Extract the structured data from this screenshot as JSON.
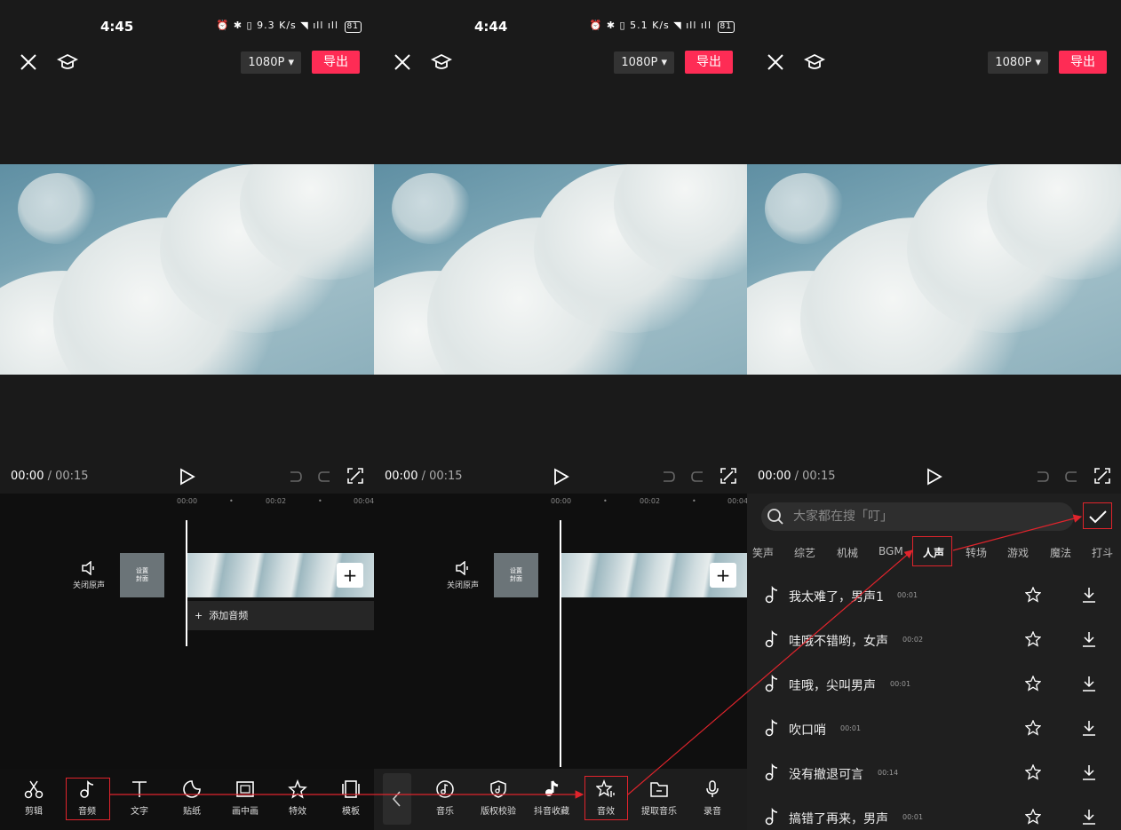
{
  "screen1": {
    "clock": "4:45",
    "net_speed": "9.3 K/s",
    "battery": "81",
    "resolution": "1080P",
    "export_label": "导出",
    "current_time": "00:00",
    "total_time": " / 00:15",
    "ruler": [
      "00:00",
      "00:02",
      "00:04"
    ],
    "mute_label": "关闭原声",
    "cover_label": [
      "设置",
      "封面"
    ],
    "add_audio_label": "添加音频",
    "tools": [
      {
        "label": "剪辑",
        "icon": "scissors-icon"
      },
      {
        "label": "音频",
        "icon": "music-note-icon"
      },
      {
        "label": "文字",
        "icon": "text-icon"
      },
      {
        "label": "贴纸",
        "icon": "sticker-icon"
      },
      {
        "label": "画中画",
        "icon": "picture-in-picture-icon"
      },
      {
        "label": "特效",
        "icon": "effects-star-icon"
      },
      {
        "label": "模板",
        "icon": "template-icon"
      }
    ]
  },
  "screen2": {
    "clock": "4:44",
    "net_speed": "5.1 K/s",
    "battery": "81",
    "resolution": "1080P",
    "export_label": "导出",
    "current_time": "00:00",
    "total_time": " / 00:15",
    "ruler": [
      "00:00",
      "00:02",
      "00:04"
    ],
    "mute_label": "关闭原声",
    "cover_label": [
      "设置",
      "封面"
    ],
    "audio_tools": [
      {
        "label": "音乐",
        "icon": "music-disc-icon"
      },
      {
        "label": "版权校验",
        "icon": "shield-check-icon"
      },
      {
        "label": "抖音收藏",
        "icon": "tiktok-icon"
      },
      {
        "label": "音效",
        "icon": "sound-effect-icon"
      },
      {
        "label": "提取音乐",
        "icon": "folder-icon"
      },
      {
        "label": "录音",
        "icon": "microphone-icon"
      }
    ]
  },
  "screen3": {
    "resolution": "1080P",
    "export_label": "导出",
    "current_time": "00:00",
    "total_time": " / 00:15",
    "search_placeholder": "大家都在搜「叮」",
    "categories": [
      "笑声",
      "综艺",
      "机械",
      "BGM",
      "人声",
      "转场",
      "游戏",
      "魔法",
      "打斗"
    ],
    "active_category": "人声",
    "sounds": [
      {
        "title": "我太难了，男声1",
        "duration": "00:01"
      },
      {
        "title": "哇哦不错哟，女声",
        "duration": "00:02"
      },
      {
        "title": "哇哦，尖叫男声",
        "duration": "00:01"
      },
      {
        "title": "吹口哨",
        "duration": "00:01"
      },
      {
        "title": "没有撤退可言",
        "duration": "00:14"
      },
      {
        "title": "搞错了再来，男声",
        "duration": "00:01"
      }
    ]
  },
  "colors": {
    "accent": "#fe2c55",
    "highlight_box": "#e0242c"
  }
}
